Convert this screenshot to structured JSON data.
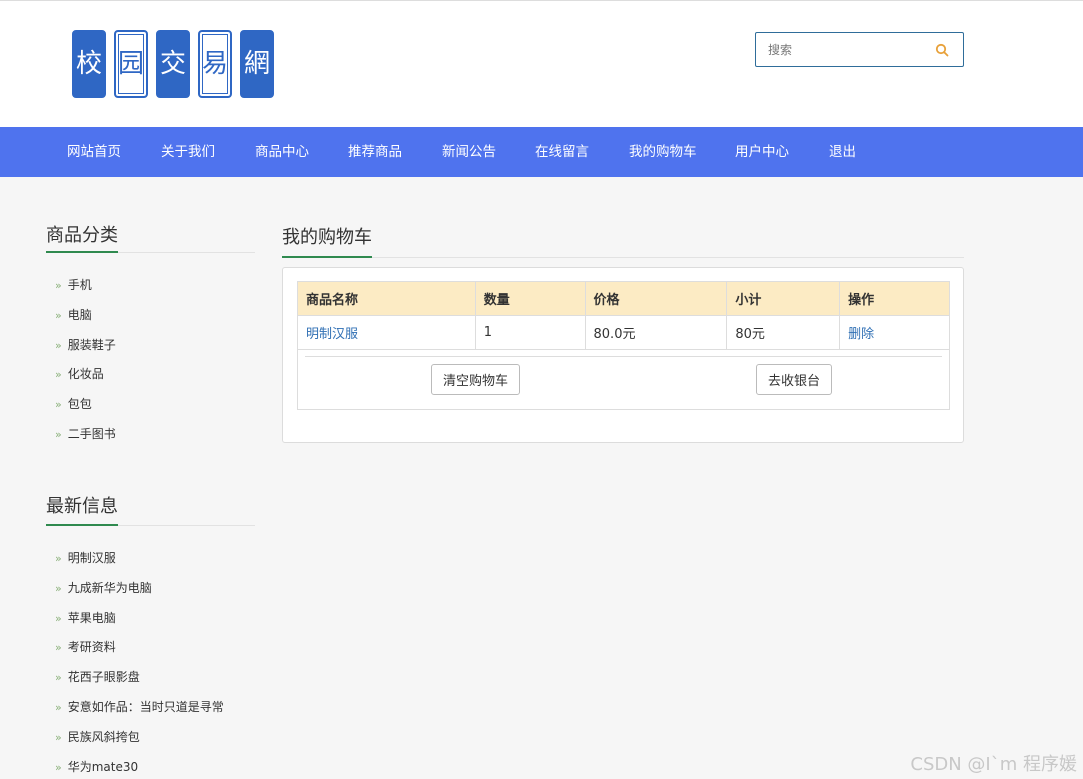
{
  "logo": {
    "chars": [
      "校",
      "园",
      "交",
      "易",
      "網"
    ]
  },
  "search": {
    "placeholder": "搜索"
  },
  "nav": {
    "items": [
      "网站首页",
      "关于我们",
      "商品中心",
      "推荐商品",
      "新闻公告",
      "在线留言",
      "我的购物车",
      "用户中心",
      "退出"
    ]
  },
  "sidebar": {
    "categories_title": "商品分类",
    "categories": [
      "手机",
      "电脑",
      "服装鞋子",
      "化妆品",
      "包包",
      "二手图书"
    ],
    "latest_title": "最新信息",
    "latest": [
      "明制汉服",
      "九成新华为电脑",
      "苹果电脑",
      "考研资料",
      "花西子眼影盘",
      "安意如作品：当时只道是寻常",
      "民族风斜挎包",
      "华为mate30"
    ],
    "bullet": "»"
  },
  "main": {
    "title": "我的购物车",
    "columns": [
      "商品名称",
      "数量",
      "价格",
      "小计",
      "操作"
    ],
    "rows": [
      {
        "name": "明制汉服",
        "qty": "1",
        "price": "80.0元",
        "subtotal": "80元",
        "action": "删除"
      }
    ],
    "clear_label": "清空购物车",
    "checkout_label": "去收银台"
  },
  "watermark": "CSDN @I`m 程序媛",
  "colors": {
    "nav_bg": "#4f73ee",
    "header_bg": "#fcebc4",
    "accent": "#2f8a4f",
    "link": "#2f6fb4",
    "logo": "#2f67c4"
  }
}
